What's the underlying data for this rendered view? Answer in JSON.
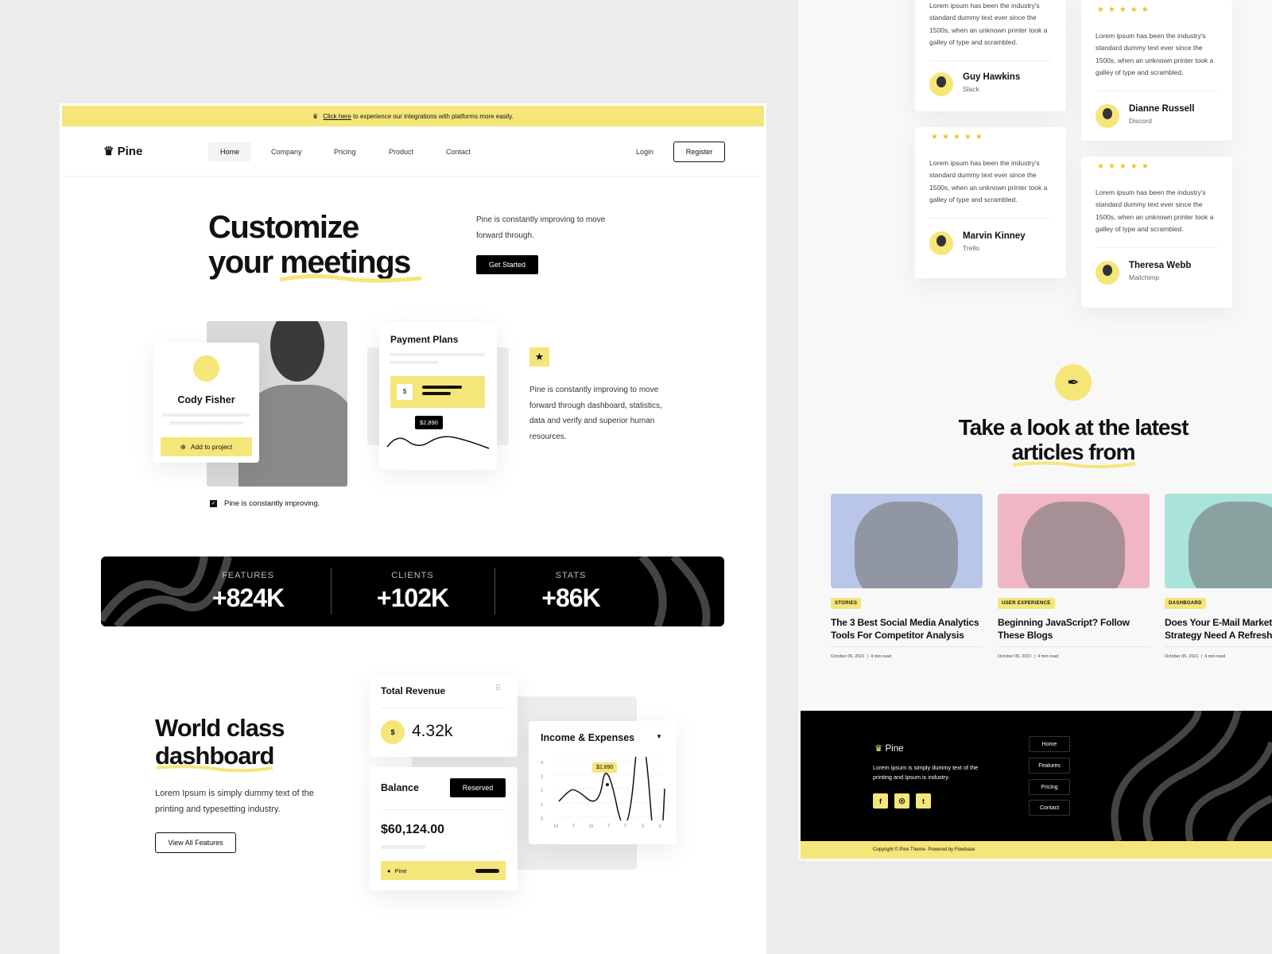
{
  "colors": {
    "accent": "#f5e67a",
    "dark": "#000000",
    "star": "#e8c52c"
  },
  "banner": {
    "link": "Click here",
    "text": " to experience our integrations with platforms more easily.",
    "icon": "crown-icon"
  },
  "brand": "Pine",
  "nav": {
    "items": [
      "Home",
      "Company",
      "Pricing",
      "Product",
      "Contact"
    ],
    "login": "Login",
    "register": "Register"
  },
  "hero": {
    "title_line1": "Customize",
    "title_line2": "your meetings",
    "desc": "Pine is constantly improving to move forward through.",
    "cta": "Get Started"
  },
  "profile": {
    "name": "Cody Fisher",
    "button": "Add to project"
  },
  "payment": {
    "title": "Payment Plans",
    "tooltip": "$2,890"
  },
  "feature": {
    "icon": "star-icon",
    "desc": "Pine is constantly improving to move forward through dashboard, statistics, data and verify and superior human resources."
  },
  "check_text": "Pine is constantly improving.",
  "stats": [
    {
      "label": "FEATURES",
      "value": "+824K"
    },
    {
      "label": "CLIENTS",
      "value": "+102K"
    },
    {
      "label": "STATS",
      "value": "+86K"
    }
  ],
  "dashboard": {
    "title_line1": "World class",
    "title_line2": "dashboard",
    "desc": "Lorem Ipsum is simply dummy text of the printing and typesetting industry.",
    "button": "View All Features",
    "revenue": {
      "title": "Total Revenue",
      "value": "4.32k"
    },
    "balance": {
      "title": "Balance",
      "button": "Reserved",
      "value": "$60,124.00",
      "item": "Pine"
    },
    "income": {
      "title": "Income & Expenses",
      "tooltip": "$2,890",
      "y_ticks": [
        "4",
        "3",
        "2",
        "1",
        "0"
      ],
      "x_ticks": [
        "M",
        "T",
        "W",
        "T",
        "F",
        "S",
        "S"
      ]
    }
  },
  "testimonials": [
    {
      "text": "Lorem ipsum has been the industry's standard dummy text ever since the 1500s, when an unknown printer took a galley of type and scrambled.",
      "name": "Guy Hawkins",
      "company": "Slack"
    },
    {
      "text": "Lorem ipsum has been the industry's standard dummy text ever since the 1500s, when an unknown printer took a galley of type and scrambled.",
      "name": "Dianne Russell",
      "company": "Discord"
    },
    {
      "text": "Lorem ipsum has been the industry's standard dummy text ever since the 1500s, when an unknown printer took a galley of type and scrambled.",
      "name": "Marvin Kinney",
      "company": "Trello"
    },
    {
      "text": "Lorem ipsum has been the industry's standard dummy text ever since the 1500s, when an unknown printer took a galley of type and scrambled.",
      "name": "Theresa Webb",
      "company": "Mailchimp"
    }
  ],
  "stars": "★★★★★",
  "articles": {
    "icon": "feather-icon",
    "title_line1": "Take a look at the latest",
    "title_line2": "articles from",
    "items": [
      {
        "tag": "STORIES",
        "title": "The 3 Best Social Media Analytics Tools For Competitor Analysis",
        "date": "October 05, 2021",
        "read": "4 min read"
      },
      {
        "tag": "USER EXPERIENCE",
        "title": "Beginning JavaScript? Follow These Blogs",
        "date": "October 05, 2021",
        "read": "4 min read"
      },
      {
        "tag": "DASHBOARD",
        "title": "Does Your E-Mail Marketing Strategy Need A Refresh",
        "date": "October 05, 2021",
        "read": "4 min read"
      }
    ]
  },
  "footer": {
    "brand": "Pine",
    "desc": "Lorem ipsum is simply dummy text of the printing and Ipsum is industry.",
    "links": [
      "Home",
      "Features",
      "Pricing",
      "Contact"
    ],
    "social": [
      "facebook-icon",
      "instagram-icon",
      "twitter-icon"
    ],
    "copyright": "Copyright © Pine Theme- Powered by Flowbase"
  }
}
